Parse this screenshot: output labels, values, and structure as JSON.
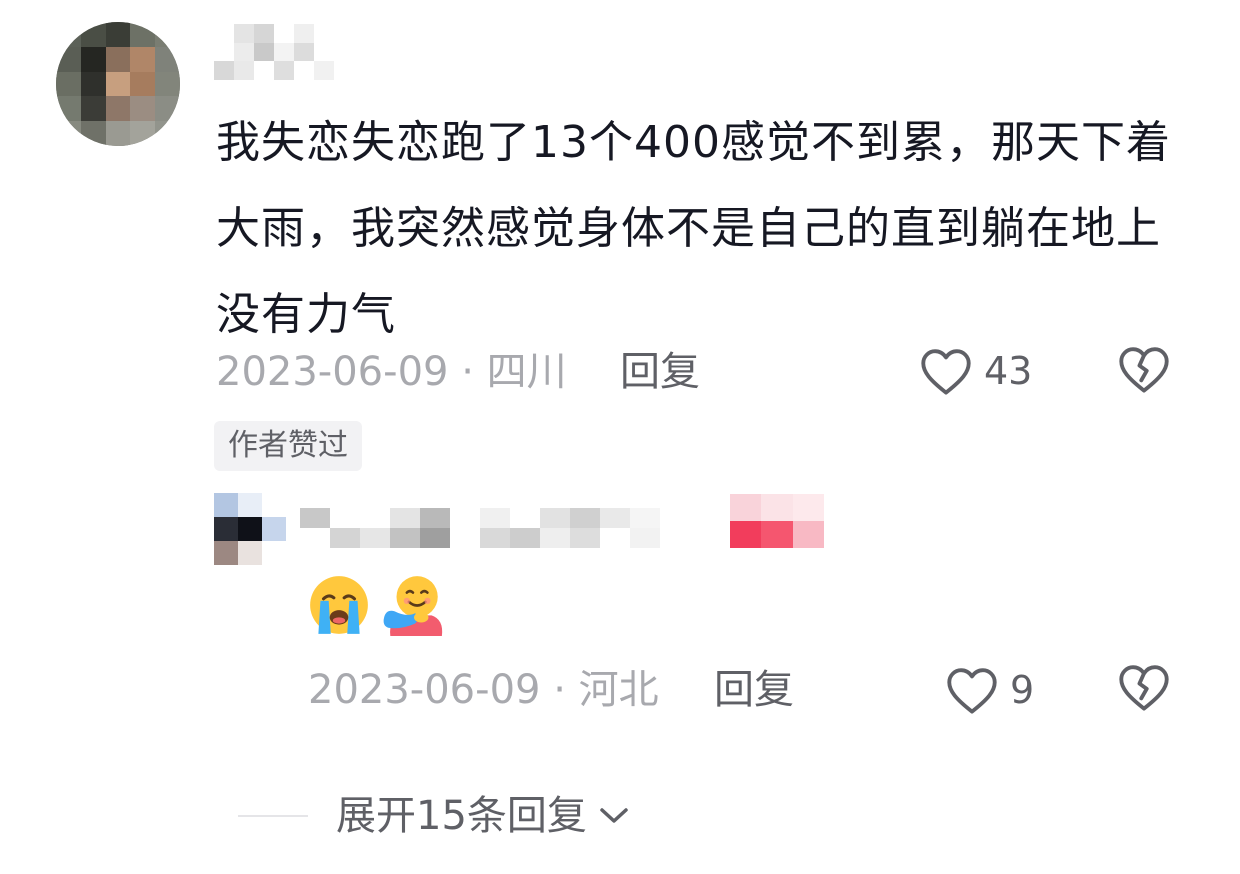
{
  "comment": {
    "text": "我失恋失恋跑了13个400感觉不到累，那天下着大雨，我突然感觉身体不是自己的直到躺在地上没有力气",
    "date": "2023-06-09",
    "location": "四川",
    "reply_label": "回复",
    "likes": "43",
    "author_badge": "作者赞过"
  },
  "reply": {
    "emojis": [
      "crying-face-emoji",
      "hugging-face-emoji"
    ],
    "date": "2023-06-09",
    "location": "河北",
    "reply_label": "回复",
    "likes": "9"
  },
  "expand": {
    "label": "展开15条回复"
  },
  "colors": {
    "text_primary": "#161823",
    "text_secondary": "#5f6066",
    "text_meta": "#a8a9ae",
    "badge_bg": "#f2f2f4",
    "tag_red": "#f23d5c"
  }
}
